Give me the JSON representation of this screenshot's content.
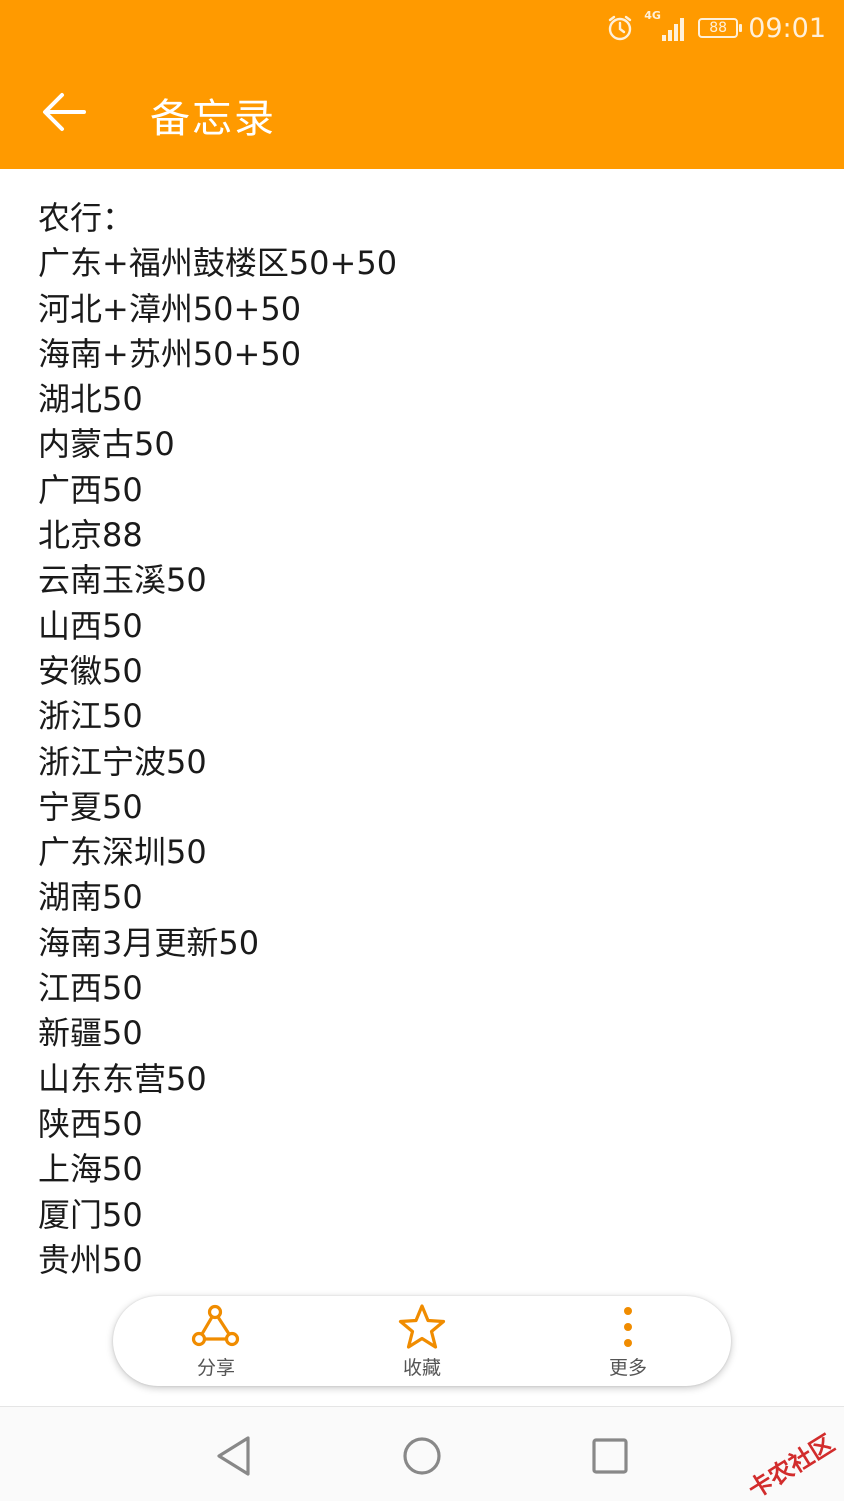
{
  "status_bar": {
    "network": "4G",
    "battery": "88",
    "time": "09:01"
  },
  "header": {
    "title": "备忘录"
  },
  "note": {
    "lines": [
      "农行：",
      "广东+福州鼓楼区50+50",
      "河北+漳州50+50",
      "海南+苏州50+50",
      "湖北50",
      "内蒙古50",
      "广西50",
      "北京88",
      "云南玉溪50",
      "山西50",
      "安徽50",
      "浙江50",
      "浙江宁波50",
      "宁夏50",
      "广东深圳50",
      "湖南50",
      "海南3月更新50",
      "江西50",
      "新疆50",
      "山东东营50",
      "陕西50",
      "上海50",
      "厦门50",
      "贵州50"
    ]
  },
  "actions": {
    "share_label": "分享",
    "favorite_label": "收藏",
    "more_label": "更多"
  },
  "watermark": "卡农社区",
  "colors": {
    "accent": "#ff9a00",
    "icon": "#f08c00"
  }
}
